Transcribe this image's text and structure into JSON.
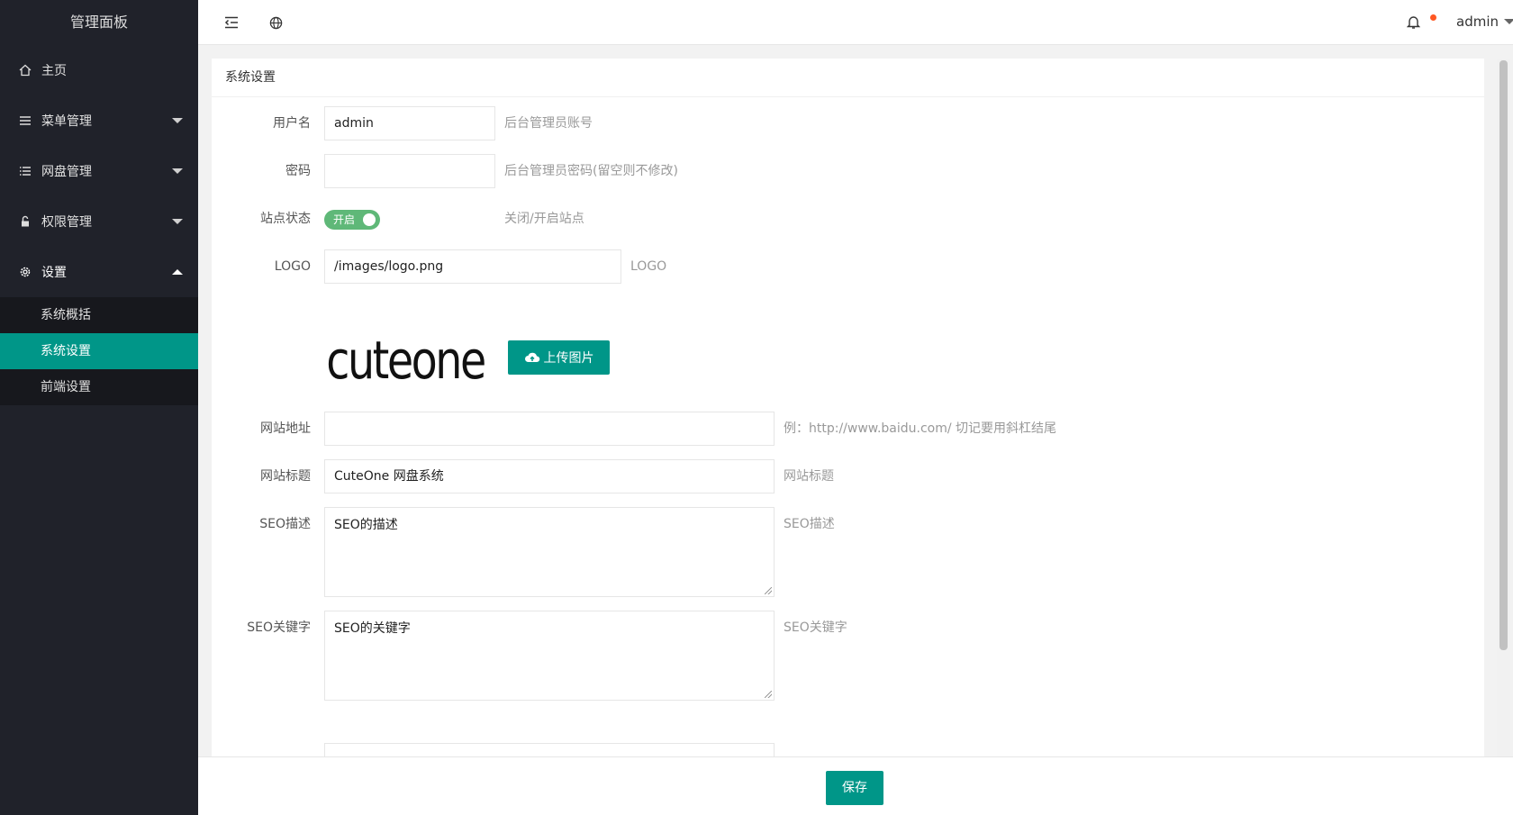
{
  "sidebar": {
    "brand": "管理面板",
    "items": [
      {
        "label": "主页",
        "icon": "home-icon"
      },
      {
        "label": "菜单管理",
        "icon": "menu-icon"
      },
      {
        "label": "网盘管理",
        "icon": "list-icon"
      },
      {
        "label": "权限管理",
        "icon": "lock-icon"
      },
      {
        "label": "设置",
        "icon": "gear-icon"
      }
    ],
    "sub_items": [
      {
        "label": "系统概括"
      },
      {
        "label": "系统设置",
        "active": true
      },
      {
        "label": "前端设置"
      }
    ]
  },
  "header": {
    "user": "admin",
    "icons": [
      "collapse-sidebar-icon",
      "globe-icon",
      "bell-icon"
    ]
  },
  "card": {
    "title": "系统设置",
    "fields": {
      "username": {
        "label": "用户名",
        "value": "admin",
        "hint": "后台管理员账号"
      },
      "password": {
        "label": "密码",
        "value": "",
        "hint": "后台管理员密码(留空则不修改)"
      },
      "site_status": {
        "label": "站点状态",
        "switch_text": "开启",
        "on": true,
        "hint": "关闭/开启站点"
      },
      "logo": {
        "label": "LOGO",
        "value": "/images/logo.png",
        "hint": "LOGO"
      },
      "upload": {
        "label": "上传图片"
      },
      "logo_text": "cuteone",
      "site_url": {
        "label": "网站地址",
        "value": "",
        "hint": "例：http://www.baidu.com/ 切记要用斜杠结尾"
      },
      "site_title": {
        "label": "网站标题",
        "value": "CuteOne 网盘系统",
        "hint": "网站标题"
      },
      "seo_desc": {
        "label": "SEO描述",
        "value": "SEO的描述",
        "hint": "SEO描述"
      },
      "seo_keywords": {
        "label": "SEO关键字",
        "value": "SEO的关键字",
        "hint": "SEO关键字"
      }
    }
  },
  "footer": {
    "save_label": "保存"
  },
  "colors": {
    "accent": "#009688",
    "sidebar": "#20222a",
    "switch_on": "#5fb878",
    "badge": "#ff5722"
  }
}
